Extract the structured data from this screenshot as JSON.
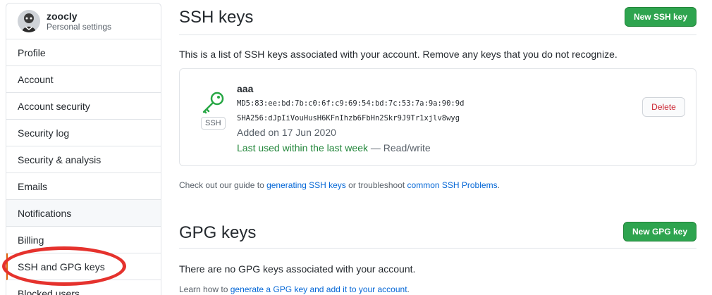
{
  "user": {
    "name": "zoocly",
    "subtitle": "Personal settings"
  },
  "sidebar": {
    "items": [
      {
        "label": "Profile"
      },
      {
        "label": "Account"
      },
      {
        "label": "Account security"
      },
      {
        "label": "Security log"
      },
      {
        "label": "Security & analysis"
      },
      {
        "label": "Emails"
      },
      {
        "label": "Notifications"
      },
      {
        "label": "Billing"
      },
      {
        "label": "SSH and GPG keys"
      },
      {
        "label": "Blocked users"
      }
    ],
    "hovered_item": "Notifications",
    "selected_item": "SSH and GPG keys"
  },
  "ssh": {
    "title": "SSH keys",
    "new_button": "New SSH key",
    "description": "This is a list of SSH keys associated with your account. Remove any keys that you do not recognize.",
    "keys": [
      {
        "name": "aaa",
        "badge": "SSH",
        "md5": "MD5:83:ee:bd:7b:c0:6f:c9:69:54:bd:7c:53:7a:9a:90:9d",
        "sha256": "SHA256:dJpIiVouHusH6KFnIhzb6FbHn2Skr9J9Tr1xjlv8wyg",
        "added": "Added on 17 Jun 2020",
        "last_used": "Last used within the last week",
        "access": " — Read/write",
        "delete_label": "Delete"
      }
    ],
    "guide": {
      "prefix": "Check out our guide to ",
      "link1": "generating SSH keys",
      "middle": " or troubleshoot ",
      "link2": "common SSH Problems",
      "suffix": "."
    }
  },
  "gpg": {
    "title": "GPG keys",
    "new_button": "New GPG key",
    "empty": "There are no GPG keys associated with your account.",
    "learn": {
      "prefix": "Learn how to ",
      "link": "generate a GPG key and add it to your account",
      "suffix": "."
    }
  },
  "colors": {
    "primary_button": "#2ea44f",
    "link": "#0366d6",
    "success": "#22863a",
    "danger": "#cb2431",
    "annotation": "#e5322d"
  },
  "icons": {
    "key": "key-icon",
    "avatar": "avatar"
  }
}
